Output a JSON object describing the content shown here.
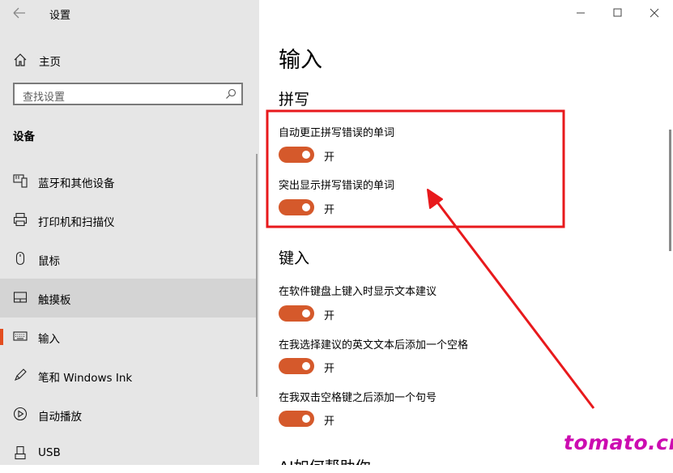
{
  "window": {
    "title": "设置",
    "controls": [
      "minimize-icon",
      "maximize-icon",
      "close-icon"
    ]
  },
  "sidebar": {
    "home_label": "主页",
    "search_placeholder": "查找设置",
    "section_title": "设备",
    "items": [
      {
        "label": "蓝牙和其他设备",
        "icon": "bluetooth-devices-icon"
      },
      {
        "label": "打印机和扫描仪",
        "icon": "printer-icon"
      },
      {
        "label": "鼠标",
        "icon": "mouse-icon"
      },
      {
        "label": "触摸板",
        "icon": "touchpad-icon"
      },
      {
        "label": "输入",
        "icon": "keyboard-icon"
      },
      {
        "label": "笔和 Windows Ink",
        "icon": "pen-icon"
      },
      {
        "label": "自动播放",
        "icon": "autoplay-icon"
      },
      {
        "label": "USB",
        "icon": "usb-icon"
      }
    ]
  },
  "main": {
    "page_title": "输入",
    "groups": [
      {
        "title": "拼写",
        "settings": [
          {
            "label": "自动更正拼写错误的单词",
            "state": "开"
          },
          {
            "label": "突出显示拼写错误的单词",
            "state": "开"
          }
        ]
      },
      {
        "title": "键入",
        "settings": [
          {
            "label": "在软件键盘上键入时显示文本建议",
            "state": "开"
          },
          {
            "label": "在我选择建议的英文文本后添加一个空格",
            "state": "开"
          },
          {
            "label": "在我双击空格键之后添加一个句号",
            "state": "开"
          }
        ]
      }
    ],
    "next_group_title": "AI如何帮助你"
  },
  "colors": {
    "accent": "#d5592b",
    "sidebar_bg": "#e6e6e6",
    "annotation": "#e8191c",
    "watermark": "#cc0bb0"
  },
  "watermark": "tomato.cm"
}
